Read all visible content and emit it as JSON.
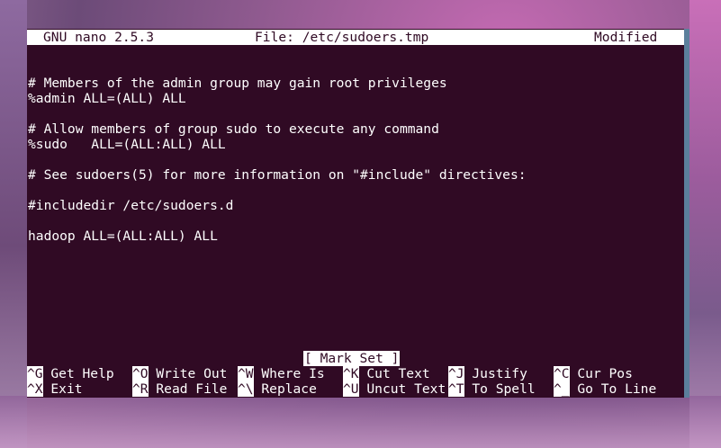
{
  "titlebar": {
    "app": "GNU nano 2.5.3",
    "file": "File: /etc/sudoers.tmp",
    "status": "Modified"
  },
  "editor": {
    "lines": [
      "# Members of the admin group may gain root privileges",
      "%admin ALL=(ALL) ALL",
      "",
      "# Allow members of group sudo to execute any command",
      "%sudo   ALL=(ALL:ALL) ALL",
      "",
      "# See sudoers(5) for more information on \"#include\" directives:",
      "",
      "#includedir /etc/sudoers.d",
      "",
      "hadoop ALL=(ALL:ALL) ALL"
    ]
  },
  "status_message": "[ Mark Set ]",
  "shortcuts": [
    {
      "key": "^G",
      "label": "Get Help"
    },
    {
      "key": "^O",
      "label": "Write Out"
    },
    {
      "key": "^W",
      "label": "Where Is"
    },
    {
      "key": "^K",
      "label": "Cut Text"
    },
    {
      "key": "^J",
      "label": "Justify"
    },
    {
      "key": "^C",
      "label": "Cur Pos"
    },
    {
      "key": "^X",
      "label": "Exit"
    },
    {
      "key": "^R",
      "label": "Read File"
    },
    {
      "key": "^\\",
      "label": "Replace"
    },
    {
      "key": "^U",
      "label": "Uncut Text"
    },
    {
      "key": "^T",
      "label": "To Spell"
    },
    {
      "key": "^_",
      "label": "Go To Line"
    }
  ],
  "colors": {
    "terminal_background": "#300a24",
    "terminal_text": "#ffffff",
    "highlight": "#ffffff"
  }
}
